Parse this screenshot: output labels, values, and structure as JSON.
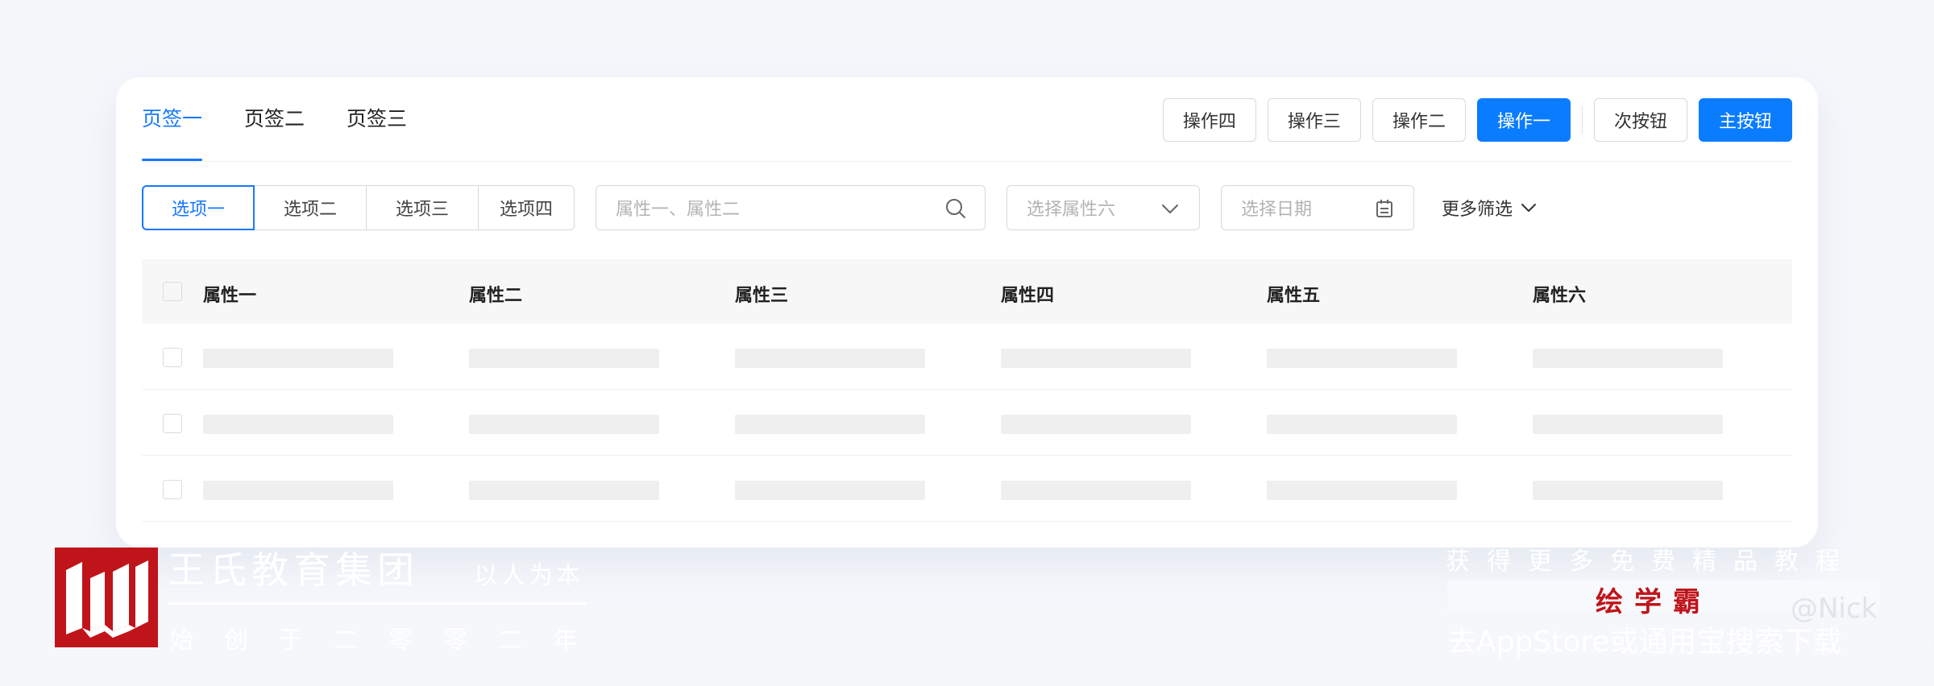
{
  "tabs": [
    "页签一",
    "页签二",
    "页签三"
  ],
  "actions": {
    "op4": "操作四",
    "op3": "操作三",
    "op2": "操作二",
    "op1": "操作一",
    "secondary": "次按钮",
    "primary": "主按钮"
  },
  "filters": {
    "segments": [
      "选项一",
      "选项二",
      "选项三",
      "选项四"
    ],
    "search_placeholder": "属性一、属性二",
    "select_placeholder": "选择属性六",
    "date_placeholder": "选择日期",
    "more_label": "更多筛选"
  },
  "table": {
    "columns": [
      "属性一",
      "属性二",
      "属性三",
      "属性四",
      "属性五",
      "属性六"
    ],
    "row_count": 3
  },
  "watermark": {
    "brand_title": "王氏教育集团",
    "brand_sub": "以人为本",
    "motto": "始创于二零零二年",
    "promo": "获得更多免费精品教程",
    "app_name": "绘学霸",
    "store_line": "去AppStore或通用宝搜索下载",
    "author": "@Nick"
  },
  "colors": {
    "accent": "#1677ff",
    "primary_button": "#0a7cff",
    "logo_red": "#c0141b"
  }
}
